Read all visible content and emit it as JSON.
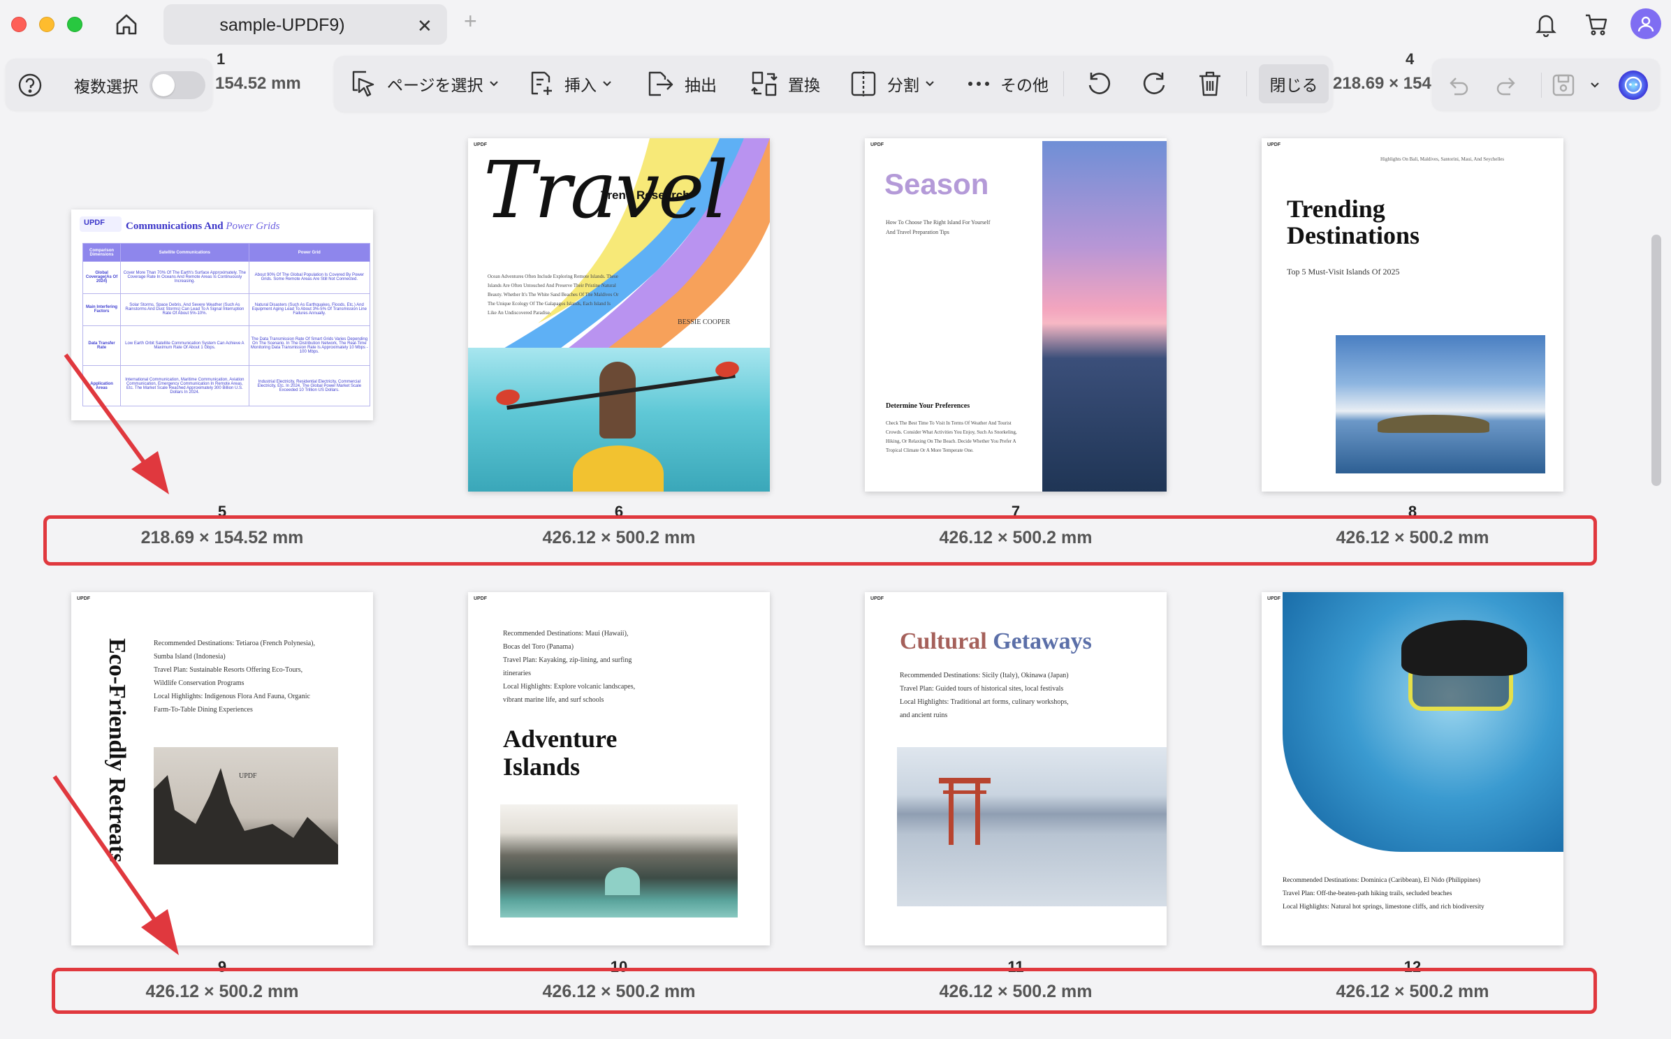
{
  "window": {
    "tab_title": "sample-UPDF9)",
    "tab_close": "✕",
    "tab_add": "+"
  },
  "toolbar": {
    "multi_select_label": "複数選択",
    "select_page_label": "ページを選択",
    "insert_label": "挿入",
    "extract_label": "抽出",
    "replace_label": "置換",
    "split_label": "分割",
    "more_label": "その他",
    "close_label": "閉じる"
  },
  "background_row": {
    "num_1": "1",
    "size_1": "154.52 mm",
    "num_4": "4",
    "size_4": "218.69 × 154"
  },
  "pages": [
    {
      "num": "5",
      "size": "218.69 × 154.52 mm"
    },
    {
      "num": "6",
      "size": "426.12 × 500.2 mm"
    },
    {
      "num": "7",
      "size": "426.12 × 500.2 mm"
    },
    {
      "num": "8",
      "size": "426.12 × 500.2 mm"
    },
    {
      "num": "9",
      "size": "426.12 × 500.2 mm"
    },
    {
      "num": "10",
      "size": "426.12 × 500.2 mm"
    },
    {
      "num": "11",
      "size": "426.12 × 500.2 mm"
    },
    {
      "num": "12",
      "size": "426.12 × 500.2 mm"
    }
  ],
  "thumb5": {
    "logo": "UPDF",
    "title_a": "Communications And",
    "title_b": "Power Grids",
    "headers": [
      "Comparison Dimensions",
      "Satellite Communications",
      "Power Grid"
    ],
    "rows": [
      [
        "Global Coverage(As Of 2024)",
        "Cover More Than 70% Of The Earth's Surface Approximately. The Coverage Rate In Oceans And Remote Areas Is Continuously Increasing.",
        "About 90% Of The Global Population Is Covered By Power Grids. Some Remote Areas Are Still Not Connected."
      ],
      [
        "Main Interfering Factors",
        "Solar Storms, Space Debris, And Severe Weather (Such As Rainstorms And Dust Storms) Can Lead To A Signal Interruption Rate Of About 5%-10%.",
        "Natural Disasters (Such As Earthquakes, Floods, Etc.) And Equipment Aging Lead To About 3%-5% Of Transmission Line Failures Annually."
      ],
      [
        "Data Transfer Rate",
        "Low Earth Orbit Satellite Communication System Can Achieve A Maximum Rate Of About 1 Gbps.",
        "The Data Transmission Rate Of Smart Grids Varies Depending On The Scenario. In The Distribution Network, The Real-Time Monitoring Data Transmission Rate Is Approximately 10 Mbps - 100 Mbps."
      ],
      [
        "Application Areas",
        "International Communication, Maritime Communication, Aviation Communication, Emergency Communication In Remote Areas, Etc. The Market Scale Reached Approximately 300 Billion U.S. Dollars In 2024.",
        "Industrial Electricity, Residential Electricity, Commercial Electricity, Etc. In 2024, The Global Power Market Scale Exceeded 10 Trillion US Dollars."
      ]
    ]
  },
  "thumb6": {
    "big": "Travel",
    "subtitle": "Trend Research",
    "body": "Ocean Adventures Often Include Exploring Remote Islands. These Islands Are Often Untouched And Preserve Their Pristine Natural Beauty. Whether It's The White Sand Beaches Of The Maldives Or The Unique Ecology Of The Galapagos Islands, Each Island Is Like An Undiscovered Paradise.",
    "author": "BESSIE COOPER"
  },
  "thumb7": {
    "title": "Season",
    "intro_1": "How To Choose The Right Island For Yourself",
    "intro_2": "And Travel Preparation Tips",
    "heading": "Determine Your Preferences",
    "body": "Check The Best Time To Visit In Terms Of Weather And Tourist Crowds. Consider What Activities You Enjoy, Such As Snorkeling, Hiking, Or Relaxing On The Beach. Decide Whether You Prefer A Tropical Climate Or A More Temperate One."
  },
  "thumb8": {
    "top": "Highlights On Bali, Maldives, Santorini, Maui, And Seychelles",
    "title_1": "Trending",
    "title_2": "Destinations",
    "subtitle": "Top 5 Must-Visit Islands Of 2025"
  },
  "thumb9": {
    "vertical": "Eco-Friendly Retreats",
    "lines": [
      "Recommended Destinations: Tetiaroa (French Polynesia),",
      "Sumba Island (Indonesia)",
      "Travel Plan: Sustainable Resorts Offering Eco-Tours,",
      "Wildlife Conservation Programs",
      "Local Highlights: Indigenous Flora And Fauna, Organic",
      "Farm-To-Table Dining Experiences"
    ],
    "img_label": "UPDF"
  },
  "thumb10": {
    "lines": [
      "Recommended Destinations: Maui (Hawaii),",
      "Bocas del Toro (Panama)",
      "Travel Plan: Kayaking, zip-lining, and surfing",
      "itineraries",
      "Local Highlights: Explore volcanic landscapes,",
      "vibrant marine life, and surf schools"
    ],
    "title_1": "Adventure",
    "title_2": "Islands"
  },
  "thumb11": {
    "title_a": "Cultural",
    "title_b": "Getaways",
    "lines": [
      "Recommended Destinations: Sicily (Italy), Okinawa (Japan)",
      "Travel Plan: Guided tours of historical sites, local festivals",
      "Local Highlights: Traditional art forms, culinary workshops,",
      "and ancient ruins"
    ]
  },
  "thumb12": {
    "lines": [
      "Recommended Destinations: Dominica (Caribbean), El Nido (Philippines)",
      "Travel Plan: Off-the-beaten-path hiking trails, secluded beaches",
      "Local Highlights: Natural hot springs, limestone cliffs, and rich biodiversity"
    ]
  },
  "colors": {
    "accent_red": "#e0383e",
    "avatar": "#7f6df2",
    "highlight": "#e0383e"
  }
}
